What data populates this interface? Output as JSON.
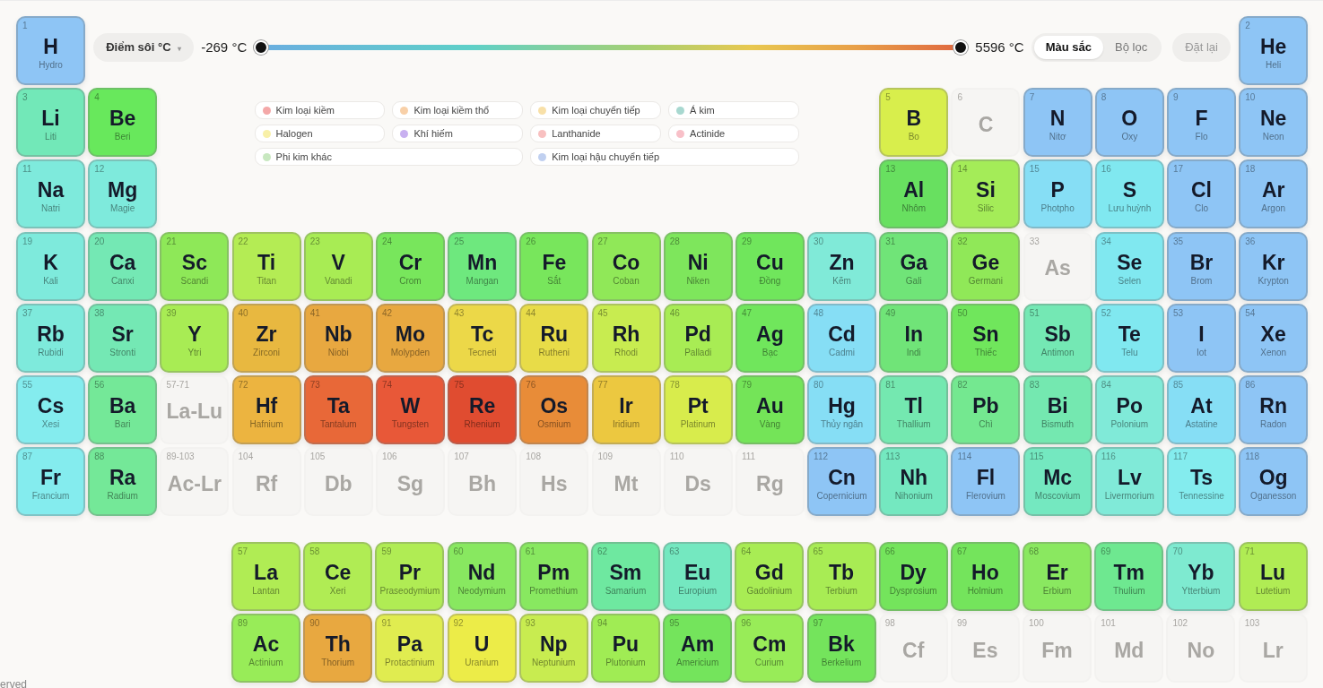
{
  "header": {
    "property_dropdown": {
      "label": "Điểm sôi °C",
      "caret": "▾"
    },
    "min_reading": "-269 °C",
    "range": {
      "low_thumb": {
        "level": 0
      },
      "high_thumb": {
        "level": 1
      }
    },
    "max_reading": "5596 °C",
    "mode_tabs": [
      {
        "label": "Màu sắc",
        "selected": true
      },
      {
        "label": "Bộ lọc",
        "selected": false
      }
    ],
    "reset_button": "Đặt lại"
  },
  "legend": [
    {
      "label": "Kim loại kiềm",
      "color": "#f4a8a8"
    },
    {
      "label": "Kim loại kiềm thổ",
      "color": "#f8d0a8"
    },
    {
      "label": "Kim loại chuyển tiếp",
      "color": "#f8e0a8"
    },
    {
      "label": "Á kim",
      "color": "#a8d8d0"
    },
    {
      "label": "Halogen",
      "color": "#f8f0a8"
    },
    {
      "label": "Khí hiếm",
      "color": "#c8b0f0"
    },
    {
      "label": "Lanthanide",
      "color": "#f8c0c0"
    },
    {
      "label": "Actinide",
      "color": "#f8c0c8"
    },
    {
      "label": "Phi kim khác",
      "color": "#c8e8c0"
    },
    {
      "label": "Kim loại hậu chuyển tiếp",
      "color": "#c0d0f0"
    }
  ],
  "periods": [
    [
      {
        "number": "1",
        "symbol": "H",
        "name": "Hydro",
        "color": "#8ec5f5",
        "dimmed": false
      },
      {
        "number": "2",
        "symbol": "He",
        "name": "Heli",
        "color": "#8ec5f5",
        "dimmed": false
      }
    ],
    [
      {
        "number": "3",
        "symbol": "Li",
        "name": "Liti",
        "color": "#72e8b8",
        "dimmed": false
      },
      {
        "number": "4",
        "symbol": "Be",
        "name": "Beri",
        "color": "#68e85c",
        "dimmed": false
      },
      {
        "number": "5",
        "symbol": "B",
        "name": "Bo",
        "color": "#d8ee4c",
        "dimmed": false
      },
      {
        "number": "6",
        "symbol": "C",
        "dimmed": true
      },
      {
        "number": "7",
        "symbol": "N",
        "name": "Nitơ",
        "color": "#8ec5f5",
        "dimmed": false
      },
      {
        "number": "8",
        "symbol": "O",
        "name": "Oxy",
        "color": "#8ec5f5",
        "dimmed": false
      },
      {
        "number": "9",
        "symbol": "F",
        "name": "Flo",
        "color": "#8ec5f5",
        "dimmed": false
      },
      {
        "number": "10",
        "symbol": "Ne",
        "name": "Neon",
        "color": "#8ec5f5",
        "dimmed": false
      }
    ],
    [
      {
        "number": "11",
        "symbol": "Na",
        "name": "Natri",
        "color": "#7eeadc",
        "dimmed": false
      },
      {
        "number": "12",
        "symbol": "Mg",
        "name": "Magie",
        "color": "#7eeadc",
        "dimmed": false
      },
      {
        "number": "13",
        "symbol": "Al",
        "name": "Nhôm",
        "color": "#68e060",
        "dimmed": false
      },
      {
        "number": "14",
        "symbol": "Si",
        "name": "Silic",
        "color": "#a4ec58",
        "dimmed": false
      },
      {
        "number": "15",
        "symbol": "P",
        "name": "Photpho",
        "color": "#86def5",
        "dimmed": false
      },
      {
        "number": "16",
        "symbol": "S",
        "name": "Lưu huỳnh",
        "color": "#80e8f0",
        "dimmed": false
      },
      {
        "number": "17",
        "symbol": "Cl",
        "name": "Clo",
        "color": "#8ec5f5",
        "dimmed": false
      },
      {
        "number": "18",
        "symbol": "Ar",
        "name": "Argon",
        "color": "#8ec5f5",
        "dimmed": false
      }
    ],
    [
      {
        "number": "19",
        "symbol": "K",
        "name": "Kali",
        "color": "#7eeadc",
        "dimmed": false
      },
      {
        "number": "20",
        "symbol": "Ca",
        "name": "Canxi",
        "color": "#74e8b4",
        "dimmed": false
      },
      {
        "number": "21",
        "symbol": "Sc",
        "name": "Scandi",
        "color": "#8ee858",
        "dimmed": false
      },
      {
        "number": "22",
        "symbol": "Ti",
        "name": "Titan",
        "color": "#b4ec54",
        "dimmed": false
      },
      {
        "number": "23",
        "symbol": "V",
        "name": "Vanadi",
        "color": "#a8ec54",
        "dimmed": false
      },
      {
        "number": "24",
        "symbol": "Cr",
        "name": "Crom",
        "color": "#78e65c",
        "dimmed": false
      },
      {
        "number": "25",
        "symbol": "Mn",
        "name": "Mangan",
        "color": "#6ee87e",
        "dimmed": false
      },
      {
        "number": "26",
        "symbol": "Fe",
        "name": "Sắt",
        "color": "#78e65c",
        "dimmed": false
      },
      {
        "number": "27",
        "symbol": "Co",
        "name": "Coban",
        "color": "#90e858",
        "dimmed": false
      },
      {
        "number": "28",
        "symbol": "Ni",
        "name": "Niken",
        "color": "#7ee65c",
        "dimmed": false
      },
      {
        "number": "29",
        "symbol": "Cu",
        "name": "Đồng",
        "color": "#70e65c",
        "dimmed": false
      },
      {
        "number": "30",
        "symbol": "Zn",
        "name": "Kẽm",
        "color": "#80ead8",
        "dimmed": false
      },
      {
        "number": "31",
        "symbol": "Ga",
        "name": "Gali",
        "color": "#70e478",
        "dimmed": false
      },
      {
        "number": "32",
        "symbol": "Ge",
        "name": "Germani",
        "color": "#90e858",
        "dimmed": false
      },
      {
        "number": "33",
        "symbol": "As",
        "dimmed": true
      },
      {
        "number": "34",
        "symbol": "Se",
        "name": "Selen",
        "color": "#80e8f0",
        "dimmed": false
      },
      {
        "number": "35",
        "symbol": "Br",
        "name": "Brom",
        "color": "#8ec5f5",
        "dimmed": false
      },
      {
        "number": "36",
        "symbol": "Kr",
        "name": "Krypton",
        "color": "#8ec5f5",
        "dimmed": false
      }
    ],
    [
      {
        "number": "37",
        "symbol": "Rb",
        "name": "Rubidi",
        "color": "#7eeadc",
        "dimmed": false
      },
      {
        "number": "38",
        "symbol": "Sr",
        "name": "Stronti",
        "color": "#74e8b4",
        "dimmed": false
      },
      {
        "number": "39",
        "symbol": "Y",
        "name": "Ytri",
        "color": "#a8ec54",
        "dimmed": false
      },
      {
        "number": "40",
        "symbol": "Zr",
        "name": "Zirconi",
        "color": "#e8b840",
        "dimmed": false
      },
      {
        "number": "41",
        "symbol": "Nb",
        "name": "Niobi",
        "color": "#e8a840",
        "dimmed": false
      },
      {
        "number": "42",
        "symbol": "Mo",
        "name": "Molypden",
        "color": "#e8a840",
        "dimmed": false
      },
      {
        "number": "43",
        "symbol": "Tc",
        "name": "Tecneti",
        "color": "#ecd848",
        "dimmed": false
      },
      {
        "number": "44",
        "symbol": "Ru",
        "name": "Rutheni",
        "color": "#e8dc48",
        "dimmed": false
      },
      {
        "number": "45",
        "symbol": "Rh",
        "name": "Rhodi",
        "color": "#c8ec50",
        "dimmed": false
      },
      {
        "number": "46",
        "symbol": "Pd",
        "name": "Palladi",
        "color": "#a8ec54",
        "dimmed": false
      },
      {
        "number": "47",
        "symbol": "Ag",
        "name": "Bạc",
        "color": "#70e65c",
        "dimmed": false
      },
      {
        "number": "48",
        "symbol": "Cd",
        "name": "Cadmi",
        "color": "#86def5",
        "dimmed": false
      },
      {
        "number": "49",
        "symbol": "In",
        "name": "Indi",
        "color": "#70e478",
        "dimmed": false
      },
      {
        "number": "50",
        "symbol": "Sn",
        "name": "Thiếc",
        "color": "#70e65c",
        "dimmed": false
      },
      {
        "number": "51",
        "symbol": "Sb",
        "name": "Antimon",
        "color": "#74e8b4",
        "dimmed": false
      },
      {
        "number": "52",
        "symbol": "Te",
        "name": "Telu",
        "color": "#80e8f0",
        "dimmed": false
      },
      {
        "number": "53",
        "symbol": "I",
        "name": "Iot",
        "color": "#8ec5f5",
        "dimmed": false
      },
      {
        "number": "54",
        "symbol": "Xe",
        "name": "Xenon",
        "color": "#8ec5f5",
        "dimmed": false
      }
    ],
    [
      {
        "number": "55",
        "symbol": "Cs",
        "name": "Xesi",
        "color": "#84ecee",
        "dimmed": false
      },
      {
        "number": "56",
        "symbol": "Ba",
        "name": "Bari",
        "color": "#74e898",
        "dimmed": false
      },
      {
        "number": "57-71",
        "symbol": "La-Lu",
        "dimmed": true
      },
      {
        "number": "72",
        "symbol": "Hf",
        "name": "Hafnium",
        "color": "#ecb440",
        "dimmed": false
      },
      {
        "number": "73",
        "symbol": "Ta",
        "name": "Tantalum",
        "color": "#e86838",
        "dimmed": false
      },
      {
        "number": "74",
        "symbol": "W",
        "name": "Tungsten",
        "color": "#e85838",
        "dimmed": false
      },
      {
        "number": "75",
        "symbol": "Re",
        "name": "Rhenium",
        "color": "#e04c30",
        "dimmed": false
      },
      {
        "number": "76",
        "symbol": "Os",
        "name": "Osmium",
        "color": "#e88c38",
        "dimmed": false
      },
      {
        "number": "77",
        "symbol": "Ir",
        "name": "Iridium",
        "color": "#ecc840",
        "dimmed": false
      },
      {
        "number": "78",
        "symbol": "Pt",
        "name": "Platinum",
        "color": "#d8ec4c",
        "dimmed": false
      },
      {
        "number": "79",
        "symbol": "Au",
        "name": "Vàng",
        "color": "#74e458",
        "dimmed": false
      },
      {
        "number": "80",
        "symbol": "Hg",
        "name": "Thủy ngân",
        "color": "#86def5",
        "dimmed": false
      },
      {
        "number": "81",
        "symbol": "Tl",
        "name": "Thallium",
        "color": "#74e8b0",
        "dimmed": false
      },
      {
        "number": "82",
        "symbol": "Pb",
        "name": "Chì",
        "color": "#74e890",
        "dimmed": false
      },
      {
        "number": "83",
        "symbol": "Bi",
        "name": "Bismuth",
        "color": "#74e8b0",
        "dimmed": false
      },
      {
        "number": "84",
        "symbol": "Po",
        "name": "Polonium",
        "color": "#80ead8",
        "dimmed": false
      },
      {
        "number": "85",
        "symbol": "At",
        "name": "Astatine",
        "color": "#86def5",
        "dimmed": false
      },
      {
        "number": "86",
        "symbol": "Rn",
        "name": "Radon",
        "color": "#8ec5f5",
        "dimmed": false
      }
    ],
    [
      {
        "number": "87",
        "symbol": "Fr",
        "name": "Francium",
        "color": "#84ecee",
        "dimmed": false
      },
      {
        "number": "88",
        "symbol": "Ra",
        "name": "Radium",
        "color": "#74e898",
        "dimmed": false
      },
      {
        "number": "89-103",
        "symbol": "Ac-Lr",
        "dimmed": true
      },
      {
        "number": "104",
        "symbol": "Rf",
        "dimmed": true
      },
      {
        "number": "105",
        "symbol": "Db",
        "dimmed": true
      },
      {
        "number": "106",
        "symbol": "Sg",
        "dimmed": true
      },
      {
        "number": "107",
        "symbol": "Bh",
        "dimmed": true
      },
      {
        "number": "108",
        "symbol": "Hs",
        "dimmed": true
      },
      {
        "number": "109",
        "symbol": "Mt",
        "dimmed": true
      },
      {
        "number": "110",
        "symbol": "Ds",
        "dimmed": true
      },
      {
        "number": "111",
        "symbol": "Rg",
        "dimmed": true
      },
      {
        "number": "112",
        "symbol": "Cn",
        "name": "Copernicium",
        "color": "#8ec5f5",
        "dimmed": false
      },
      {
        "number": "113",
        "symbol": "Nh",
        "name": "Nihonium",
        "color": "#74e8c0",
        "dimmed": false
      },
      {
        "number": "114",
        "symbol": "Fl",
        "name": "Flerovium",
        "color": "#8ec5f5",
        "dimmed": false
      },
      {
        "number": "115",
        "symbol": "Mc",
        "name": "Moscovium",
        "color": "#74e8c0",
        "dimmed": false
      },
      {
        "number": "116",
        "symbol": "Lv",
        "name": "Livermorium",
        "color": "#80ead8",
        "dimmed": false
      },
      {
        "number": "117",
        "symbol": "Ts",
        "name": "Tennessine",
        "color": "#84ecee",
        "dimmed": false
      },
      {
        "number": "118",
        "symbol": "Og",
        "name": "Oganesson",
        "color": "#8ec5f5",
        "dimmed": false
      }
    ]
  ],
  "lanthanides": [
    {
      "number": "57",
      "symbol": "La",
      "name": "Lantan",
      "color": "#b0ec54",
      "dimmed": false
    },
    {
      "number": "58",
      "symbol": "Ce",
      "name": "Xeri",
      "color": "#b0ec54",
      "dimmed": false
    },
    {
      "number": "59",
      "symbol": "Pr",
      "name": "Praseodymium",
      "color": "#b0ec54",
      "dimmed": false
    },
    {
      "number": "60",
      "symbol": "Nd",
      "name": "Neodymium",
      "color": "#88e860",
      "dimmed": false
    },
    {
      "number": "61",
      "symbol": "Pm",
      "name": "Promethium",
      "color": "#88e860",
      "dimmed": false
    },
    {
      "number": "62",
      "symbol": "Sm",
      "name": "Samarium",
      "color": "#6ee8a0",
      "dimmed": false
    },
    {
      "number": "63",
      "symbol": "Eu",
      "name": "Europium",
      "color": "#74e8c0",
      "dimmed": false
    },
    {
      "number": "64",
      "symbol": "Gd",
      "name": "Gadolinium",
      "color": "#a8ec54",
      "dimmed": false
    },
    {
      "number": "65",
      "symbol": "Tb",
      "name": "Terbium",
      "color": "#a8ec54",
      "dimmed": false
    },
    {
      "number": "66",
      "symbol": "Dy",
      "name": "Dysprosium",
      "color": "#74e45c",
      "dimmed": false
    },
    {
      "number": "67",
      "symbol": "Ho",
      "name": "Holmium",
      "color": "#74e45c",
      "dimmed": false
    },
    {
      "number": "68",
      "symbol": "Er",
      "name": "Erbium",
      "color": "#8ae860",
      "dimmed": false
    },
    {
      "number": "69",
      "symbol": "Tm",
      "name": "Thulium",
      "color": "#6ee890",
      "dimmed": false
    },
    {
      "number": "70",
      "symbol": "Yb",
      "name": "Ytterbium",
      "color": "#7eead0",
      "dimmed": false
    },
    {
      "number": "71",
      "symbol": "Lu",
      "name": "Lutetium",
      "color": "#b0ec54",
      "dimmed": false
    }
  ],
  "actinides": [
    {
      "number": "89",
      "symbol": "Ac",
      "name": "Actinium",
      "color": "#98ec58",
      "dimmed": false
    },
    {
      "number": "90",
      "symbol": "Th",
      "name": "Thorium",
      "color": "#e8a840",
      "dimmed": false
    },
    {
      "number": "91",
      "symbol": "Pa",
      "name": "Protactinium",
      "color": "#e0ec50",
      "dimmed": false
    },
    {
      "number": "92",
      "symbol": "U",
      "name": "Uranium",
      "color": "#ecec48",
      "dimmed": false
    },
    {
      "number": "93",
      "symbol": "Np",
      "name": "Neptunium",
      "color": "#c8ec50",
      "dimmed": false
    },
    {
      "number": "94",
      "symbol": "Pu",
      "name": "Plutonium",
      "color": "#a0ec54",
      "dimmed": false
    },
    {
      "number": "95",
      "symbol": "Am",
      "name": "Americium",
      "color": "#74e45c",
      "dimmed": false
    },
    {
      "number": "96",
      "symbol": "Cm",
      "name": "Curium",
      "color": "#98ec58",
      "dimmed": false
    },
    {
      "number": "97",
      "symbol": "Bk",
      "name": "Berkelium",
      "color": "#74e45c",
      "dimmed": false
    },
    {
      "number": "98",
      "symbol": "Cf",
      "dimmed": true
    },
    {
      "number": "99",
      "symbol": "Es",
      "dimmed": true
    },
    {
      "number": "100",
      "symbol": "Fm",
      "dimmed": true
    },
    {
      "number": "101",
      "symbol": "Md",
      "dimmed": true
    },
    {
      "number": "102",
      "symbol": "No",
      "dimmed": true
    },
    {
      "number": "103",
      "symbol": "Lr",
      "dimmed": true
    }
  ],
  "footer": "erved"
}
